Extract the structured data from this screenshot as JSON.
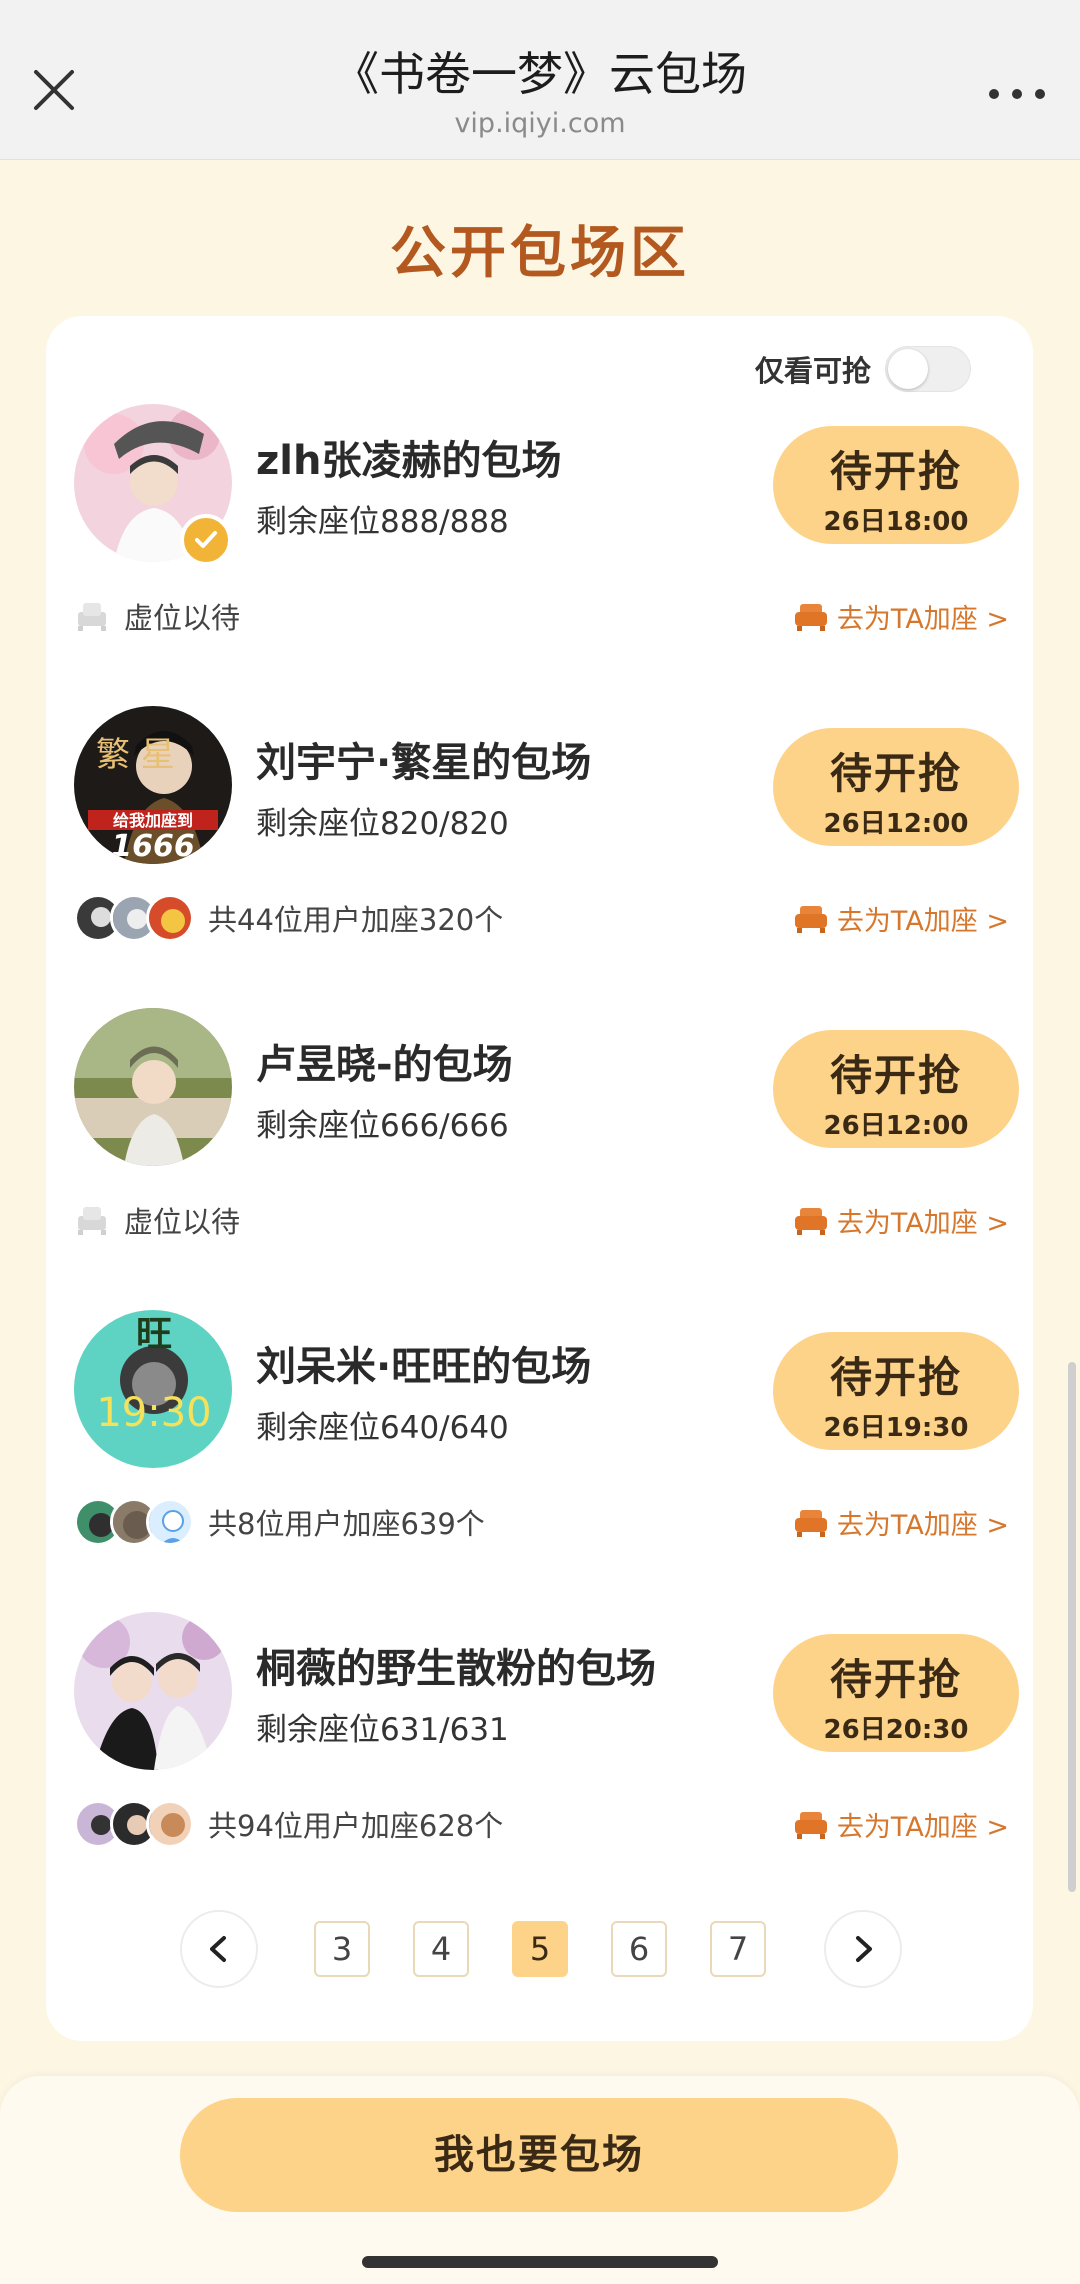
{
  "nav": {
    "title": "《书卷一梦》云包场",
    "url": "vip.iqiyi.com",
    "close_icon": "close-icon",
    "more_icon": "more-icon"
  },
  "section_title": "公开包场区",
  "filter": {
    "label": "仅看可抢",
    "toggle_on": false
  },
  "entries": [
    {
      "name": "zlh张凌赫的包场",
      "seats": "剩余座位888/888",
      "status": "待开抢",
      "time": "26日18:00",
      "footer": "虚位以待",
      "join": "去为TA加座 >",
      "verified": true
    },
    {
      "name": "刘宇宁·繁星的包场",
      "seats": "剩余座位820/820",
      "status": "待开抢",
      "time": "26日12:00",
      "footer": "共44位用户加座320个",
      "join": "去为TA加座 >",
      "avatar_text_top": "繁  星",
      "avatar_text_sub": "给我加座到",
      "avatar_text_num": "1666"
    },
    {
      "name": "卢昱晓-的包场",
      "seats": "剩余座位666/666",
      "status": "待开抢",
      "time": "26日12:00",
      "footer": "虚位以待",
      "join": "去为TA加座 >"
    },
    {
      "name": "刘呆米·旺旺的包场",
      "seats": "剩余座位640/640",
      "status": "待开抢",
      "time": "26日19:30",
      "footer": "共8位用户加座639个",
      "join": "去为TA加座 >",
      "avatar_text_top": "旺",
      "avatar_text_num": "19:30"
    },
    {
      "name": "桐薇的野生散粉的包场",
      "seats": "剩余座位631/631",
      "status": "待开抢",
      "time": "26日20:30",
      "footer": "共94位用户加座628个",
      "join": "去为TA加座 >"
    }
  ],
  "pagination": {
    "pages": [
      "3",
      "4",
      "5",
      "6",
      "7"
    ],
    "current": "5"
  },
  "cta": "我也要包场",
  "colors": {
    "accent": "#fdd38a",
    "title": "#b3581f",
    "link": "#d5772c",
    "bg": "#fdf6e3"
  }
}
